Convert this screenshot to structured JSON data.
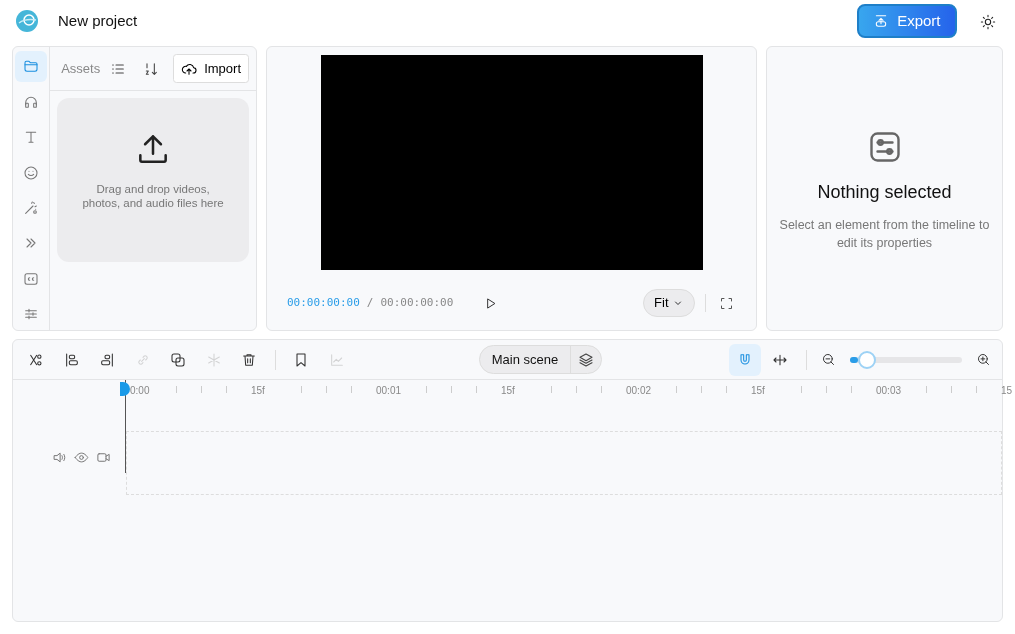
{
  "header": {
    "title": "New project",
    "export_label": "Export"
  },
  "sidebar": {
    "items": [
      {
        "kind": "folder",
        "selected": true
      },
      {
        "kind": "headphones",
        "selected": false
      },
      {
        "kind": "text",
        "selected": false
      },
      {
        "kind": "smile",
        "selected": false
      },
      {
        "kind": "wand",
        "selected": false
      },
      {
        "kind": "transitions",
        "selected": false
      },
      {
        "kind": "captions",
        "selected": false
      },
      {
        "kind": "sliders",
        "selected": false
      }
    ]
  },
  "assets": {
    "title": "Assets",
    "import_label": "Import",
    "dropzone_text": "Drag and drop videos, photos, and audio files here"
  },
  "player": {
    "current_time": "00:00:00:00",
    "separator": "/",
    "total_time": "00:00:00:00",
    "fit_label": "Fit"
  },
  "properties": {
    "title": "Nothing selected",
    "hint": "Select an element from the timeline to edit its properties"
  },
  "timeline": {
    "tools": [
      {
        "kind": "split",
        "disabled": false
      },
      {
        "kind": "align-left",
        "disabled": false
      },
      {
        "kind": "align-right",
        "disabled": false
      },
      {
        "kind": "link",
        "disabled": true
      },
      {
        "kind": "duplicate",
        "disabled": false
      },
      {
        "kind": "freeze",
        "disabled": true
      },
      {
        "kind": "delete",
        "disabled": false
      },
      {
        "kind": "bookmark",
        "disabled": false
      },
      {
        "kind": "graph",
        "disabled": true
      }
    ],
    "scene_label": "Main scene",
    "snap_on": true,
    "zoom": {
      "level": 0.08
    },
    "ruler": [
      "0:00",
      "15f",
      "00:01",
      "15f",
      "00:02",
      "15f",
      "00:03",
      "15"
    ]
  }
}
